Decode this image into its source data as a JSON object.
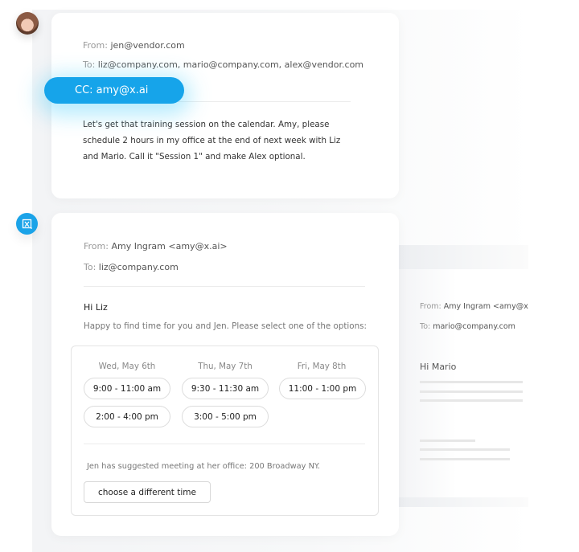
{
  "email_1": {
    "from_label": "From:",
    "from_value": "jen@vendor.com",
    "to_label": "To:",
    "to_value": "liz@company.com, mario@company.com, alex@vendor.com",
    "cc_pill": "CC: amy@x.ai",
    "body": "Let's get that training session on the calendar. Amy, please schedule 2 hours in my office at the end of next week with Liz and Mario. Call it \"Session 1\" and make Alex optional.",
    "avatar_icon": "user-avatar-photo"
  },
  "email_2": {
    "badge_icon": "xai-logo-icon",
    "from_label": "From:",
    "from_value": "Amy Ingram <amy@x.ai>",
    "to_label": "To:",
    "to_value": "liz@company.com",
    "greeting": "Hi Liz",
    "intro": "Happy to find time for you and Jen. Please select one of the options:",
    "days": [
      {
        "label": "Wed, May 6th",
        "slots": [
          "9:00 - 11:00 am",
          "2:00 - 4:00 pm"
        ]
      },
      {
        "label": "Thu, May 7th",
        "slots": [
          "9:30 - 11:30 am",
          "3:00 - 5:00 pm"
        ]
      },
      {
        "label": "Fri, May 8th",
        "slots": [
          "11:00 - 1:00 pm"
        ]
      }
    ],
    "location_note": "Jen has suggested meeting at her office: 200 Broadway NY.",
    "different_time_button": "choose a different time"
  },
  "email_3": {
    "from_label": "From:",
    "from_value": "Amy Ingram <amy@x",
    "to_label": "To:",
    "to_value": "mario@company.com",
    "greeting": "Hi Mario"
  },
  "colors": {
    "accent": "#16a4ea",
    "badge": "#1ba3e8"
  }
}
